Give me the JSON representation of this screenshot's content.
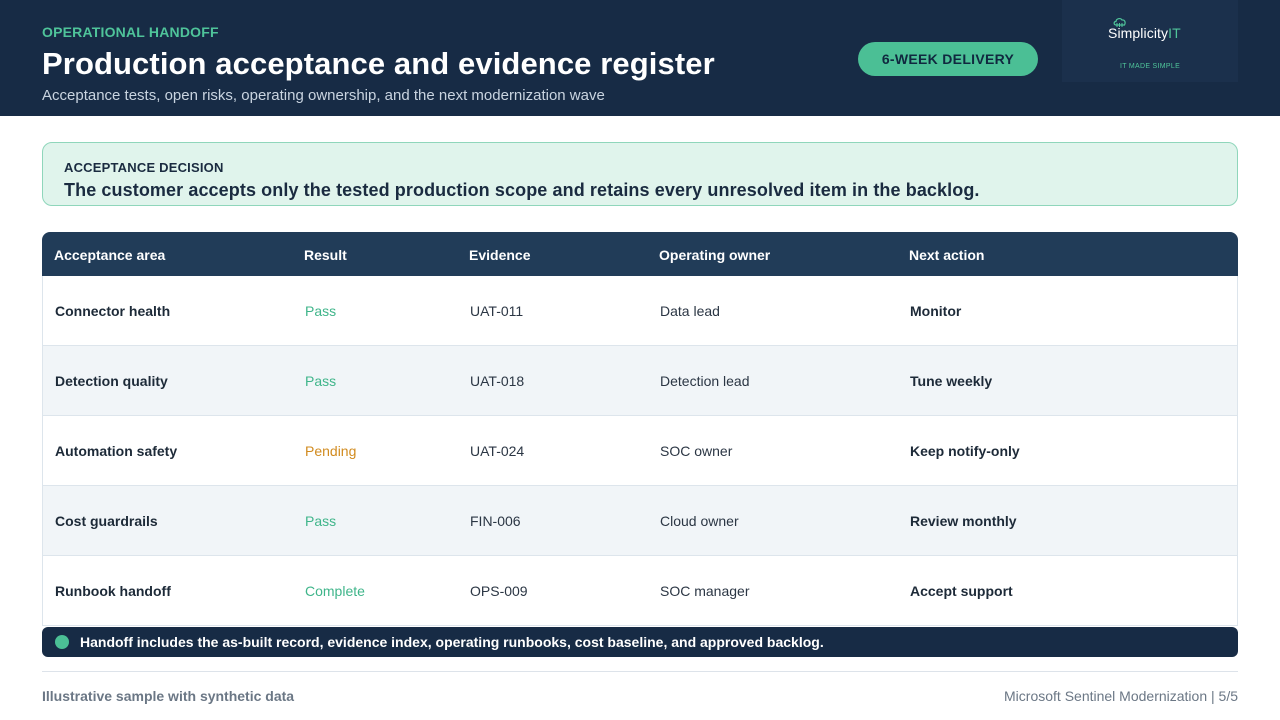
{
  "header": {
    "eyebrow": "OPERATIONAL HANDOFF",
    "title": "Production acceptance and evidence register",
    "subtitle": "Acceptance tests, open risks, operating ownership, and the next modernization wave",
    "badge": "6-WEEK DELIVERY",
    "logo": {
      "name_main": "Simplicity",
      "name_accent": "IT",
      "tagline": "IT MADE SIMPLE",
      "icon": "cloud-icon"
    }
  },
  "decision": {
    "label": "ACCEPTANCE DECISION",
    "text": "The customer accepts only the tested production scope and retains every unresolved item in the backlog."
  },
  "table": {
    "columns": [
      "Acceptance area",
      "Result",
      "Evidence",
      "Operating owner",
      "Next action"
    ],
    "rows": [
      {
        "area": "Connector health",
        "result": "Pass",
        "evidence": "UAT-011",
        "owner": "Data lead",
        "action": "Monitor"
      },
      {
        "area": "Detection quality",
        "result": "Pass",
        "evidence": "UAT-018",
        "owner": "Detection lead",
        "action": "Tune weekly"
      },
      {
        "area": "Automation safety",
        "result": "Pending",
        "evidence": "UAT-024",
        "owner": "SOC owner",
        "action": "Keep notify-only"
      },
      {
        "area": "Cost guardrails",
        "result": "Pass",
        "evidence": "FIN-006",
        "owner": "Cloud owner",
        "action": "Review monthly"
      },
      {
        "area": "Runbook handoff",
        "result": "Complete",
        "evidence": "OPS-009",
        "owner": "SOC manager",
        "action": "Accept support"
      }
    ]
  },
  "note": {
    "text": "Handoff includes the as-built record, evidence index, operating runbooks, cost baseline, and approved backlog."
  },
  "footer": {
    "left": "Illustrative sample with synthetic data",
    "right": "Microsoft Sentinel Modernization | 5/5"
  },
  "colors": {
    "navy": "#172b45",
    "accent_green": "#4bbf95",
    "pass": "#3fb58a",
    "pending": "#d18b1f",
    "decision_bg": "#e0f4ec"
  }
}
